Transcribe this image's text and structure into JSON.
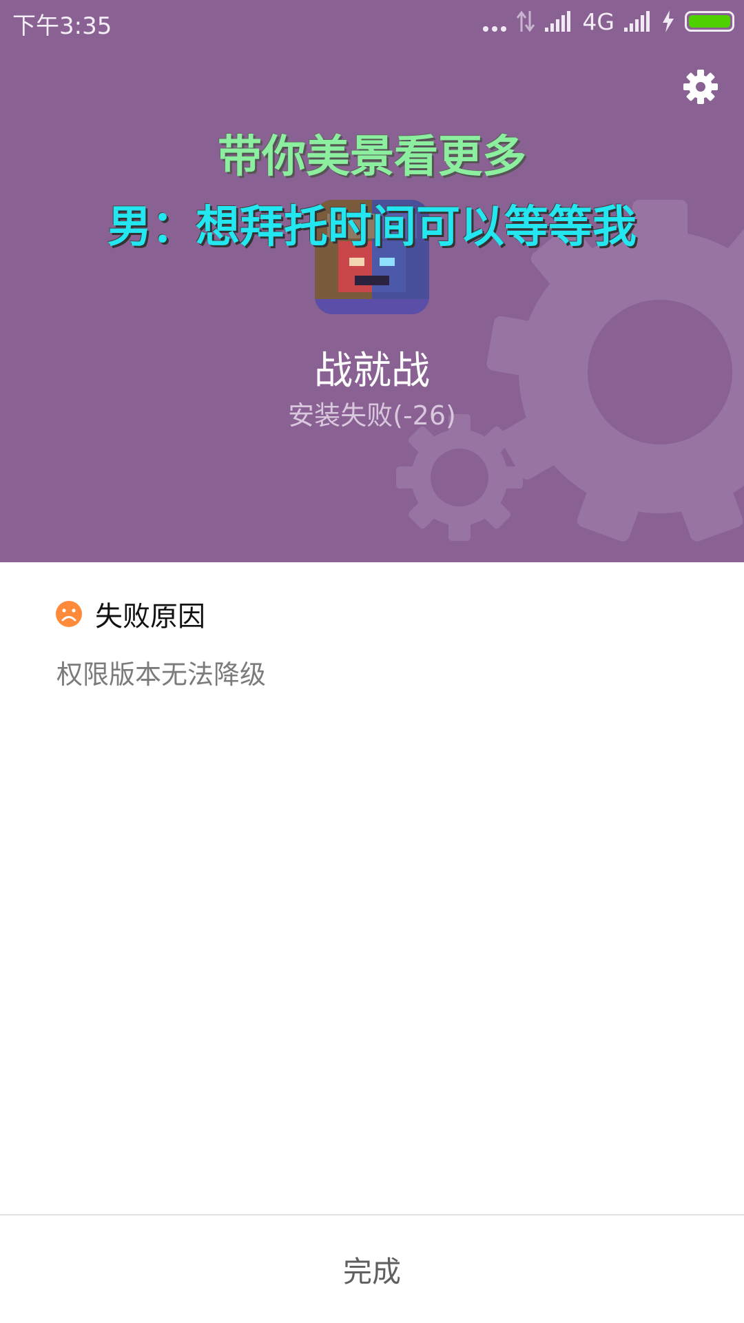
{
  "status_bar": {
    "time": "下午3:35",
    "network_type": "4G",
    "battery_color": "#4fd100"
  },
  "header": {
    "background_color": "#896293",
    "overlay_line1": "带你美景看更多",
    "overlay_line2": "男：想拜托时间可以等等我",
    "app_name": "战就战",
    "install_status": "安装失败(-26)",
    "settings_icon": "gear-icon"
  },
  "failure": {
    "title": "失败原因",
    "icon": "sad-face-icon",
    "icon_color": "#ff8a3a",
    "reason": "权限版本无法降级"
  },
  "footer": {
    "done_label": "完成"
  }
}
